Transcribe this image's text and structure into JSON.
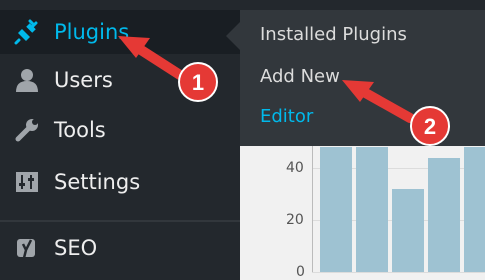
{
  "sidebar": {
    "items": [
      {
        "label": "Plugins",
        "icon": "plugin-icon",
        "active": true
      },
      {
        "label": "Users",
        "icon": "user-icon"
      },
      {
        "label": "Tools",
        "icon": "wrench-icon"
      },
      {
        "label": "Settings",
        "icon": "sliders-icon"
      },
      {
        "label": "SEO",
        "icon": "yoast-icon"
      }
    ]
  },
  "submenu": {
    "items": [
      {
        "label": "Installed Plugins"
      },
      {
        "label": "Add New"
      },
      {
        "label": "Editor"
      }
    ]
  },
  "chart_data": {
    "type": "bar",
    "y_ticks": [
      "40",
      "20",
      "0"
    ],
    "values": [
      48,
      48,
      32,
      44,
      48
    ]
  },
  "annotations": {
    "step1": "1",
    "step2": "2"
  },
  "colors": {
    "accent": "#00b9eb",
    "sidebar_bg": "#23282d",
    "arrow_red": "#e53935"
  }
}
